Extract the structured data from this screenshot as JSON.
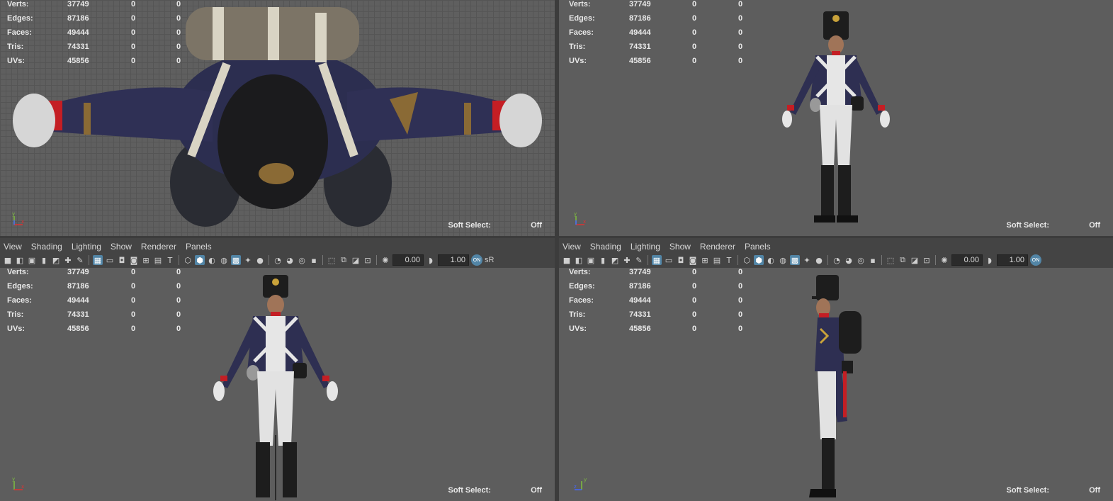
{
  "hud": {
    "rows": [
      {
        "label": "Verts:",
        "v1": "37749",
        "v2": "0",
        "v3": "0"
      },
      {
        "label": "Edges:",
        "v1": "87186",
        "v2": "0",
        "v3": "0"
      },
      {
        "label": "Faces:",
        "v1": "49444",
        "v2": "0",
        "v3": "0"
      },
      {
        "label": "Tris:",
        "v1": "74331",
        "v2": "0",
        "v3": "0"
      },
      {
        "label": "UVs:",
        "v1": "45856",
        "v2": "0",
        "v3": "0"
      }
    ],
    "soft_select_label": "Soft Select:",
    "soft_select_value": "Off"
  },
  "axis": {
    "y": "y",
    "x": "x",
    "z": "z"
  },
  "menu": [
    "View",
    "Shading",
    "Lighting",
    "Show",
    "Renderer",
    "Panels"
  ],
  "toolbar": {
    "field_a": "0.00",
    "field_b": "1.00",
    "srgb": "sR"
  },
  "colors": {
    "accent": "#5285a6",
    "coat": "#2e2f52",
    "white": "#e6e6e6",
    "red": "#c41e24",
    "black": "#1d1d1d"
  }
}
